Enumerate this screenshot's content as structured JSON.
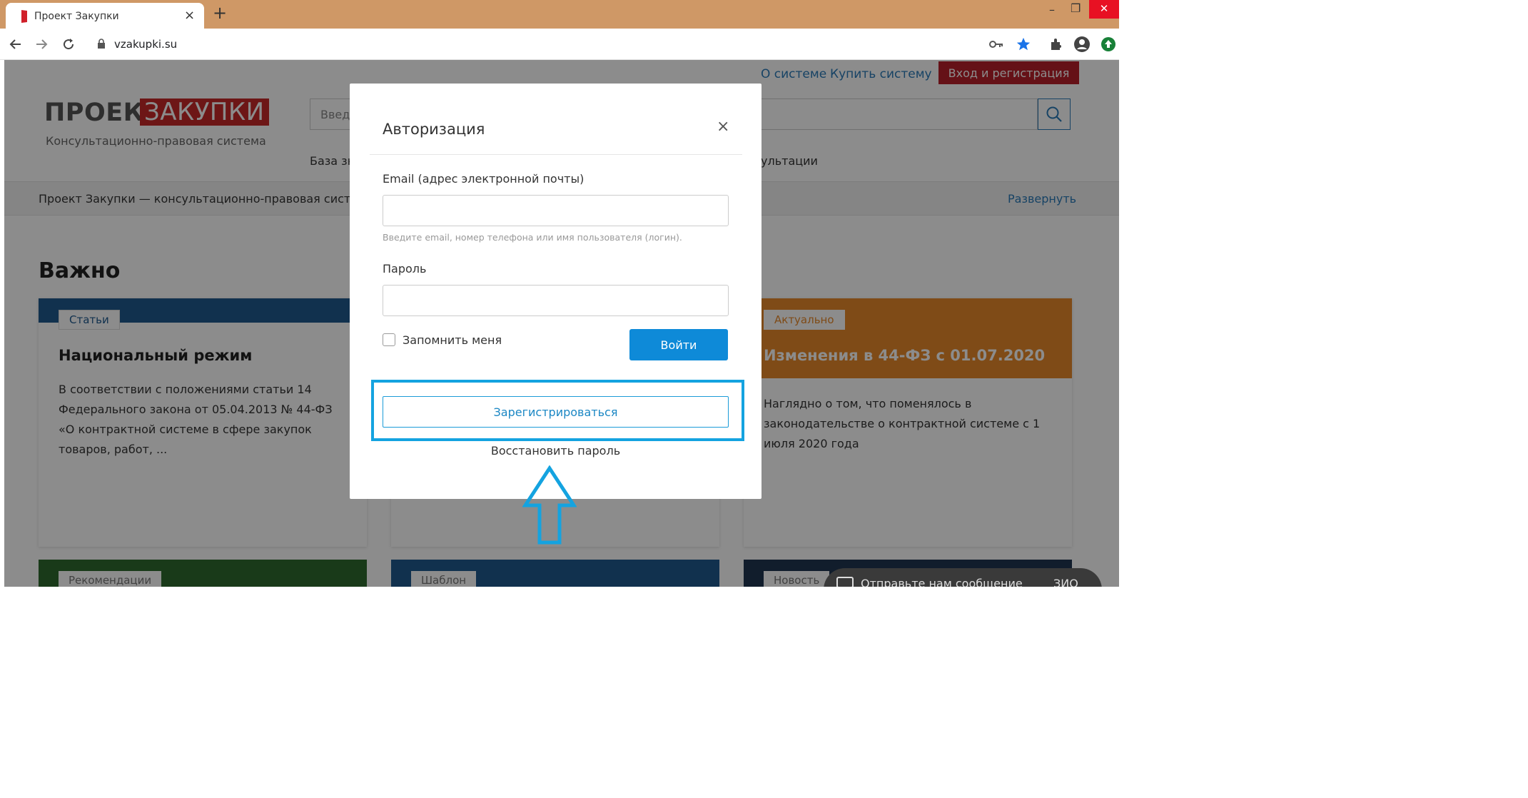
{
  "browser": {
    "tab_title": "Проект Закупки",
    "tab_close": "×",
    "new_tab": "+",
    "url": "vzakupki.su",
    "window_minimize": "–",
    "window_restore": "❐",
    "window_close": "✕",
    "icons": [
      "back-icon",
      "forward-icon",
      "reload-icon",
      "lock-icon",
      "key-icon",
      "star-icon",
      "extensions-icon",
      "profile-icon",
      "update-icon"
    ]
  },
  "site": {
    "top_links": [
      "О системе",
      "Купить систему"
    ],
    "login_button": "Вход и регистрация",
    "logo_part1": "ПРОЕКТ",
    "logo_part2": "ЗАКУПКИ",
    "slogan": "Консультационно-правовая система",
    "search_placeholder": "Введ",
    "nav": [
      "База зн",
      "ультации"
    ],
    "breadcrumb": "Проект Закупки — консультационно-правовая система",
    "expand_label": "Развернуть",
    "section_title": "Важно",
    "cards": [
      {
        "tag": "Статьи",
        "title": "Национальный режим",
        "text": "В соответствии с положениями статьи 14 Федерального закона от 05.04.2013 № 44-ФЗ «О контрактной системе в сфере закупок товаров, работ, ...",
        "color": "#1f5a8f"
      },
      {
        "tag": "Актуально",
        "title": "Изменения в 44-ФЗ с 01.07.2020",
        "text": "Наглядно о том, что поменялось в законодательстве о контрактной системе с 1 июля 2020 года",
        "color": "#e8892a"
      }
    ],
    "bottom_cards": [
      {
        "tag": "Рекомендации",
        "color": "#2e6b2e"
      },
      {
        "tag": "Шаблон",
        "color": "#1f5a8f"
      },
      {
        "tag": "Новость",
        "color": "#1f3550"
      }
    ],
    "chat": {
      "text": "Отправьте нам сообщение",
      "tail": "ЗИО"
    }
  },
  "modal": {
    "title": "Авторизация",
    "close": "×",
    "email_label": "Email (адрес электронной почты)",
    "email_value": "",
    "email_hint": "Введите email, номер телефона или имя пользователя (логин).",
    "password_label": "Пароль",
    "password_value": "",
    "remember_label": "Запомнить меня",
    "submit_label": "Войти",
    "register_label": "Зарегистрироваться",
    "restore_label": "Восстановить пароль",
    "highlight_color": "#14a3e0"
  }
}
